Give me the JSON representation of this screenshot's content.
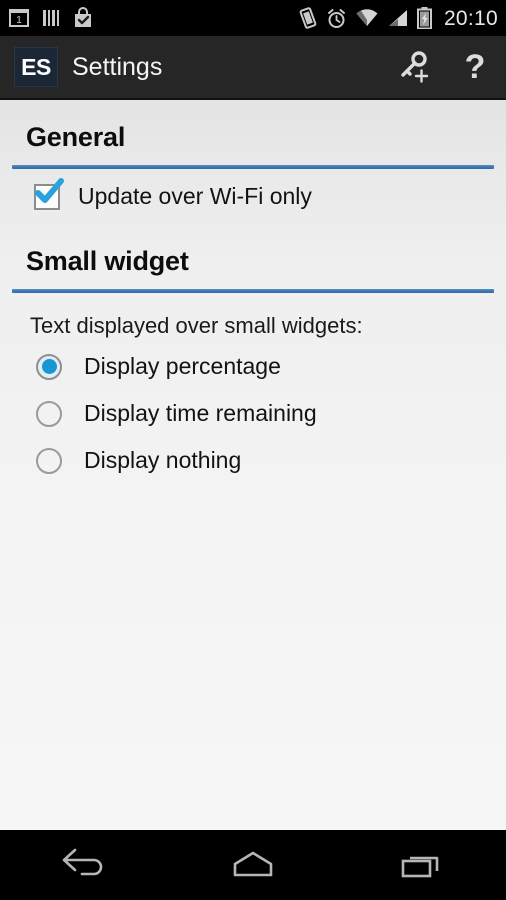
{
  "status_bar": {
    "background": "#000000",
    "time": "20:10",
    "left_icons": [
      {
        "name": "calendar-icon",
        "label": "1"
      },
      {
        "name": "barcode-icon",
        "label": ""
      },
      {
        "name": "play-store-bag-icon",
        "label": ""
      }
    ],
    "right_icons": [
      {
        "name": "vibrate-icon",
        "label": ""
      },
      {
        "name": "alarm-clock-icon",
        "label": ""
      },
      {
        "name": "wifi-icon",
        "label": ""
      },
      {
        "name": "cellular-signal-icon",
        "label": ""
      },
      {
        "name": "battery-charging-icon",
        "label": ""
      }
    ]
  },
  "action_bar": {
    "background": "#262626",
    "logo_text": "ES",
    "logo_background": "#1b2736",
    "title": "Settings",
    "actions": [
      {
        "name": "add-key-icon",
        "label": ""
      },
      {
        "name": "help-icon",
        "label": "?"
      }
    ]
  },
  "accent_color": "#3d7cb4",
  "control_accent_color": "#1797d4",
  "content_background": "#f2f2f2",
  "sections": [
    {
      "title": "General",
      "items": [
        {
          "type": "checkbox",
          "label": "Update over Wi-Fi only",
          "checked": true
        }
      ]
    },
    {
      "title": "Small widget",
      "hint": "Text displayed over small widgets:",
      "items": [
        {
          "type": "radio",
          "label": "Display percentage",
          "checked": true
        },
        {
          "type": "radio",
          "label": "Display time remaining",
          "checked": false
        },
        {
          "type": "radio",
          "label": "Display nothing",
          "checked": false
        }
      ]
    }
  ],
  "nav_bar": {
    "background": "#000000",
    "buttons": [
      {
        "name": "back-icon",
        "label": ""
      },
      {
        "name": "home-icon",
        "label": ""
      },
      {
        "name": "recents-icon",
        "label": ""
      }
    ]
  }
}
